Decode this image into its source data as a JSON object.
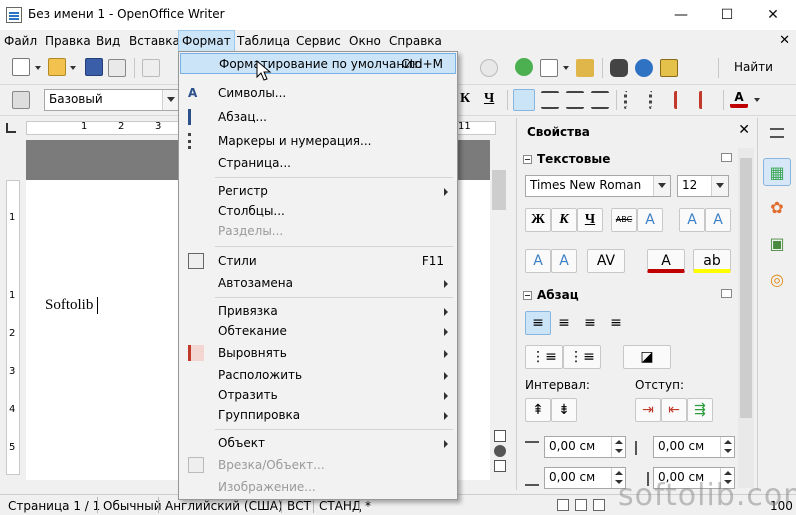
{
  "window": {
    "title": "Без имени 1 - OpenOffice Writer",
    "minimize_glyph": "—",
    "maximize_glyph": "☐",
    "close_glyph": "✕"
  },
  "menubar": {
    "items": [
      {
        "label": "Файл"
      },
      {
        "label": "Правка"
      },
      {
        "label": "Вид"
      },
      {
        "label": "Вставка"
      },
      {
        "label": "Формат"
      },
      {
        "label": "Таблица"
      },
      {
        "label": "Сервис"
      },
      {
        "label": "Окно"
      },
      {
        "label": "Справка"
      }
    ],
    "active": "Формат",
    "doc_close_glyph": "✕"
  },
  "toolbar_standard": {
    "find_label": "Найти"
  },
  "toolbar_formatting": {
    "paragraph_style": "Базовый",
    "bold_glyph": "Ч",
    "italic_glyph": "К",
    "underline_glyph": "Ч"
  },
  "ruler": {
    "marks": [
      "1",
      "2",
      "3"
    ],
    "right_mark": "11"
  },
  "vruler": {
    "marks": [
      "1",
      "1",
      "2",
      "3",
      "4",
      "5"
    ]
  },
  "document": {
    "text": "Softolib"
  },
  "format_menu": {
    "items": [
      {
        "label": "Форматирование по умолчанию",
        "shortcut": "Ctrl+M",
        "highlighted": true
      },
      {
        "label": "Символы..."
      },
      {
        "label": "Абзац..."
      },
      {
        "label": "Маркеры и нумерация..."
      },
      {
        "label": "Страница..."
      },
      {
        "label": "Регистр"
      },
      {
        "label": "Столбцы..."
      },
      {
        "label": "Разделы..."
      },
      {
        "label": "Стили",
        "shortcut": "F11"
      },
      {
        "label": "Автозамена"
      },
      {
        "label": "Привязка"
      },
      {
        "label": "Обтекание"
      },
      {
        "label": "Выровнять"
      },
      {
        "label": "Расположить"
      },
      {
        "label": "Отразить"
      },
      {
        "label": "Группировка"
      },
      {
        "label": "Объект"
      },
      {
        "label": "Врезка/Объект..."
      },
      {
        "label": "Изображение..."
      }
    ]
  },
  "sidebar": {
    "title": "Свойства",
    "close_glyph": "✕",
    "text_section": {
      "title": "Текстовые",
      "font_name": "Times New Roman",
      "font_size": "12",
      "bold": "Ж",
      "italic": "К",
      "underline": "Ч",
      "strike": "ABC"
    },
    "paragraph_section": {
      "title": "Абзац",
      "spacing_label": "Интервал:",
      "indent_label": "Отступ:",
      "spacing_above": "0,00 см",
      "indent_before": "0,00 см",
      "spacing_below": "0,00 см",
      "indent_after": "0,00 см"
    }
  },
  "statusbar": {
    "page": "Страница  1 / 1",
    "style": "Обычный",
    "language": "Английский (США)",
    "insert_mode": "ВСТ",
    "selection_mode": "СТАНД",
    "modified": "*",
    "zoom": "100"
  },
  "watermark": {
    "text": "softolib.com"
  },
  "colors": {
    "highlight": "#cce4f7",
    "highlight_border": "#78b1e3",
    "font_color_red": "#c00000",
    "highlight_yellow": "#ffff00"
  }
}
